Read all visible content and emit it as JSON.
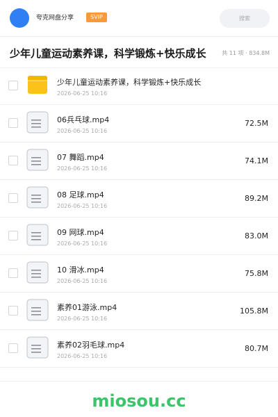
{
  "header": {
    "brand": "夸克网盘分享",
    "badge": "SVIP",
    "search_placeholder": "搜索"
  },
  "folder": {
    "title": "少年儿童运动素养课，科学锻炼+快乐成长",
    "meta": "共 11 项 · 834.8M"
  },
  "items": [
    {
      "type": "folder",
      "name": "少年儿童运动素养课，科学锻炼+快乐成长",
      "date": "2026-06-25 10:16",
      "size": ""
    },
    {
      "type": "file",
      "name": "06兵乓球.mp4",
      "date": "2026-06-25 10:16",
      "size": "72.5M"
    },
    {
      "type": "file",
      "name": "07 舞蹈.mp4",
      "date": "2026-06-25 10:16",
      "size": "74.1M"
    },
    {
      "type": "file",
      "name": "08 足球.mp4",
      "date": "2026-06-25 10:16",
      "size": "89.2M"
    },
    {
      "type": "file",
      "name": "09 网球.mp4",
      "date": "2026-06-25 10:16",
      "size": "83.0M"
    },
    {
      "type": "file",
      "name": "10 滑冰.mp4",
      "date": "2026-06-25 10:16",
      "size": "75.8M"
    },
    {
      "type": "file",
      "name": "素养01游泳.mp4",
      "date": "2026-06-25 10:16",
      "size": "105.8M"
    },
    {
      "type": "file",
      "name": "素养02羽毛球.mp4",
      "date": "2026-06-25 10:16",
      "size": "80.7M"
    }
  ],
  "icons": {
    "folder": "folder-icon",
    "file": "video-file-icon"
  },
  "colors": {
    "accent": "#2f7ff5",
    "svip": "#f79a3c",
    "folder": "#fbc21a",
    "watermark": "#3cc46a"
  },
  "watermark": "miosou.cc"
}
